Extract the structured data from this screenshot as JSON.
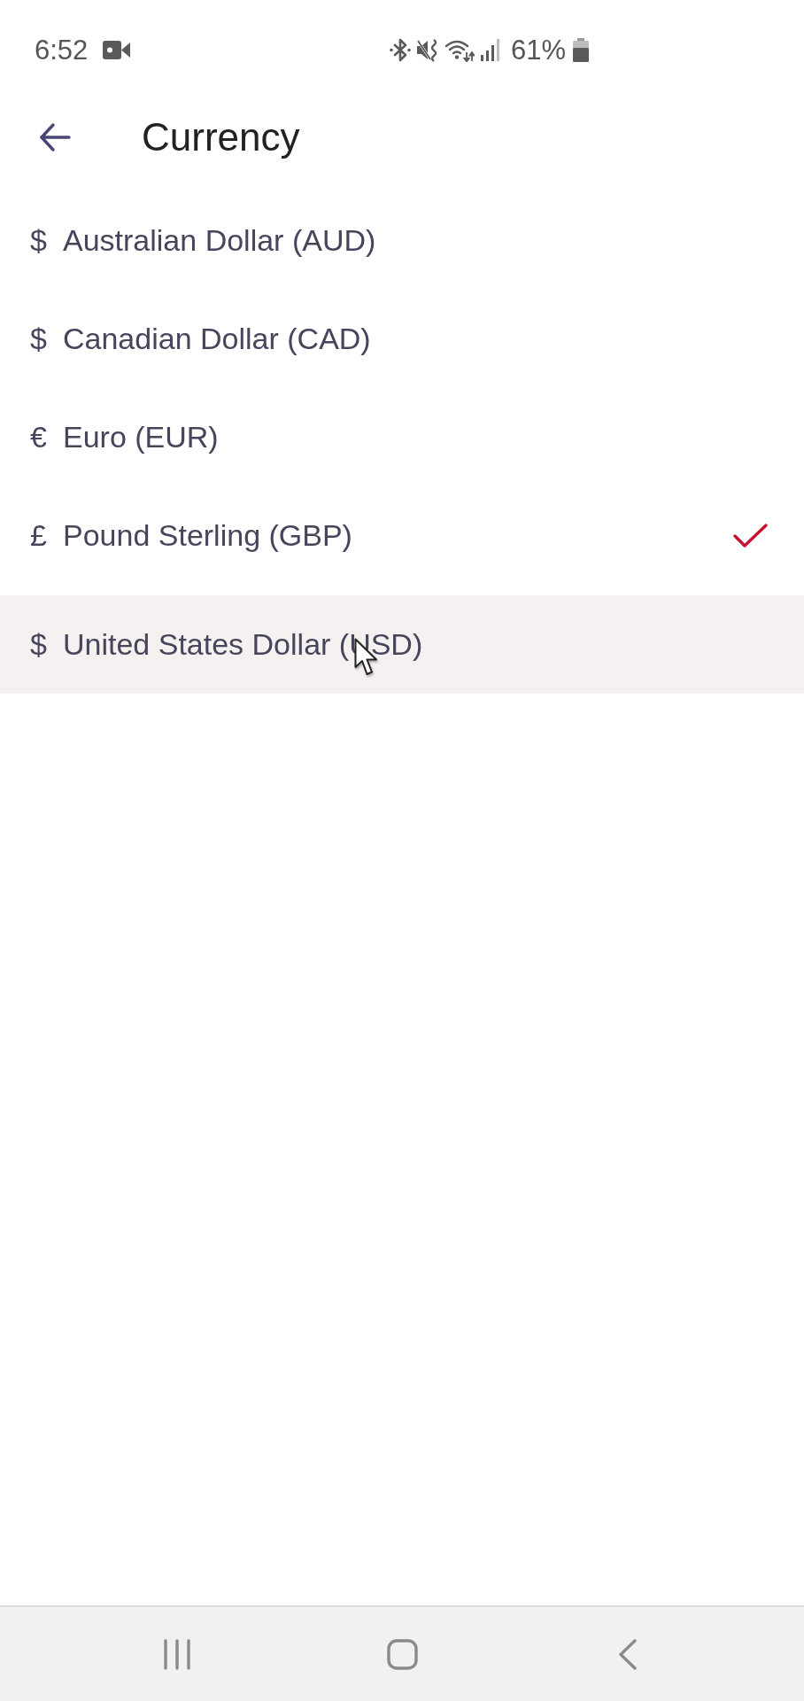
{
  "status_bar": {
    "time": "6:52",
    "battery": "61%"
  },
  "header": {
    "title": "Currency"
  },
  "currencies": [
    {
      "symbol": "$",
      "name": "Australian Dollar (AUD)",
      "selected": false,
      "highlighted": false
    },
    {
      "symbol": "$",
      "name": "Canadian Dollar (CAD)",
      "selected": false,
      "highlighted": false
    },
    {
      "symbol": "€",
      "name": "Euro (EUR)",
      "selected": false,
      "highlighted": false
    },
    {
      "symbol": "£",
      "name": "Pound Sterling (GBP)",
      "selected": true,
      "highlighted": false
    },
    {
      "symbol": "$",
      "name": "United States Dollar (USD)",
      "selected": false,
      "highlighted": true
    }
  ]
}
